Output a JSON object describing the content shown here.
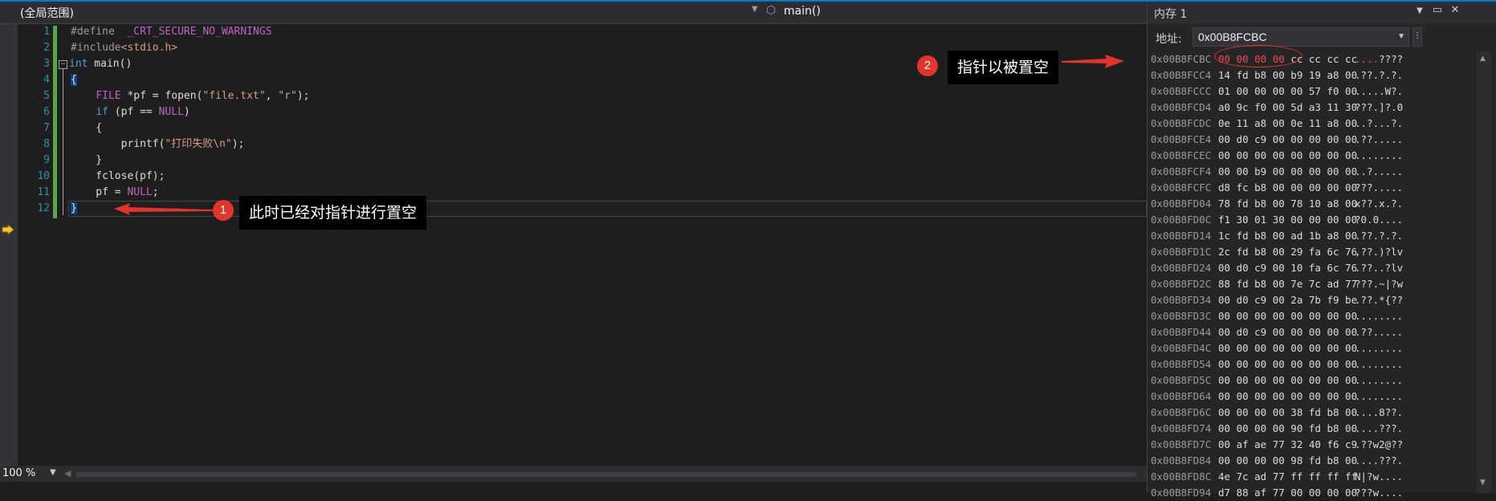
{
  "editor": {
    "scope_label": "(全局范围)",
    "function_label": "main()",
    "zoom": "100 %",
    "lines": [
      {
        "no": "1",
        "code": "#define  _CRT_SECURE_NO_WARNINGS"
      },
      {
        "no": "2",
        "code": "#include<stdio.h>"
      },
      {
        "no": "3",
        "code": "int main()"
      },
      {
        "no": "4",
        "code": "{"
      },
      {
        "no": "5",
        "code": "    FILE *pf = fopen(\"file.txt\", \"r\");"
      },
      {
        "no": "6",
        "code": "    if (pf == NULL)"
      },
      {
        "no": "7",
        "code": "    {"
      },
      {
        "no": "8",
        "code": "        printf(\"打印失败\\n\");"
      },
      {
        "no": "9",
        "code": "    }"
      },
      {
        "no": "10",
        "code": "    fclose(pf);"
      },
      {
        "no": "11",
        "code": "    pf = NULL;"
      },
      {
        "no": "12",
        "code": "}"
      }
    ]
  },
  "annotations": [
    {
      "num": "1",
      "text": "此时已经对指针进行置空"
    },
    {
      "num": "2",
      "text": "指针以被置空"
    }
  ],
  "memory": {
    "title": "内存 1",
    "address_label": "地址:",
    "address_value": "0x00B8FCBC",
    "rows": [
      {
        "addr": "0x00B8FCBC",
        "bytes": "00 00 00 00 cc cc cc cc",
        "ascii": "....????"
      },
      {
        "addr": "0x00B8FCC4",
        "bytes": "14 fd b8 00 b9 19 a8 00",
        "ascii": ".??.?.?."
      },
      {
        "addr": "0x00B8FCCC",
        "bytes": "01 00 00 00 00 57 f0 00",
        "ascii": ".....W?."
      },
      {
        "addr": "0x00B8FCD4",
        "bytes": "a0 9c f0 00 5d a3 11 30",
        "ascii": "???.]?.0"
      },
      {
        "addr": "0x00B8FCDC",
        "bytes": "0e 11 a8 00 0e 11 a8 00",
        "ascii": "..?...?."
      },
      {
        "addr": "0x00B8FCE4",
        "bytes": "00 d0 c9 00 00 00 00 00",
        "ascii": ".??....."
      },
      {
        "addr": "0x00B8FCEC",
        "bytes": "00 00 00 00 00 00 00 00",
        "ascii": "........"
      },
      {
        "addr": "0x00B8FCF4",
        "bytes": "00 00 b9 00 00 00 00 00",
        "ascii": "..?....."
      },
      {
        "addr": "0x00B8FCFC",
        "bytes": "d8 fc b8 00 00 00 00 00",
        "ascii": "???....."
      },
      {
        "addr": "0x00B8FD04",
        "bytes": "78 fd b8 00 78 10 a8 00",
        "ascii": "x??.x.?."
      },
      {
        "addr": "0x00B8FD0C",
        "bytes": "f1 30 01 30 00 00 00 00",
        "ascii": "?0.0...."
      },
      {
        "addr": "0x00B8FD14",
        "bytes": "1c fd b8 00 ad 1b a8 00",
        "ascii": ".??.?.?."
      },
      {
        "addr": "0x00B8FD1C",
        "bytes": "2c fd b8 00 29 fa 6c 76",
        "ascii": ",??.)?lv"
      },
      {
        "addr": "0x00B8FD24",
        "bytes": "00 d0 c9 00 10 fa 6c 76",
        "ascii": ".??..?lv"
      },
      {
        "addr": "0x00B8FD2C",
        "bytes": "88 fd b8 00 7e 7c ad 77",
        "ascii": "???.~|?w"
      },
      {
        "addr": "0x00B8FD34",
        "bytes": "00 d0 c9 00 2a 7b f9 be",
        "ascii": ".??.*{??"
      },
      {
        "addr": "0x00B8FD3C",
        "bytes": "00 00 00 00 00 00 00 00",
        "ascii": "........"
      },
      {
        "addr": "0x00B8FD44",
        "bytes": "00 d0 c9 00 00 00 00 00",
        "ascii": ".??....."
      },
      {
        "addr": "0x00B8FD4C",
        "bytes": "00 00 00 00 00 00 00 00",
        "ascii": "........"
      },
      {
        "addr": "0x00B8FD54",
        "bytes": "00 00 00 00 00 00 00 00",
        "ascii": "........"
      },
      {
        "addr": "0x00B8FD5C",
        "bytes": "00 00 00 00 00 00 00 00",
        "ascii": "........"
      },
      {
        "addr": "0x00B8FD64",
        "bytes": "00 00 00 00 00 00 00 00",
        "ascii": "........"
      },
      {
        "addr": "0x00B8FD6C",
        "bytes": "00 00 00 00 38 fd b8 00",
        "ascii": "....8??."
      },
      {
        "addr": "0x00B8FD74",
        "bytes": "00 00 00 00 90 fd b8 00",
        "ascii": "....???."
      },
      {
        "addr": "0x00B8FD7C",
        "bytes": "00 af ae 77 32 40 f6 c9",
        "ascii": ".??w2@??"
      },
      {
        "addr": "0x00B8FD84",
        "bytes": "00 00 00 00 98 fd b8 00",
        "ascii": "....???."
      },
      {
        "addr": "0x00B8FD8C",
        "bytes": "4e 7c ad 77 ff ff ff ff",
        "ascii": "N|?w...."
      },
      {
        "addr": "0x00B8FD94",
        "bytes": "d7 88 af 77 00 00 00 00",
        "ascii": "???w...."
      }
    ]
  }
}
